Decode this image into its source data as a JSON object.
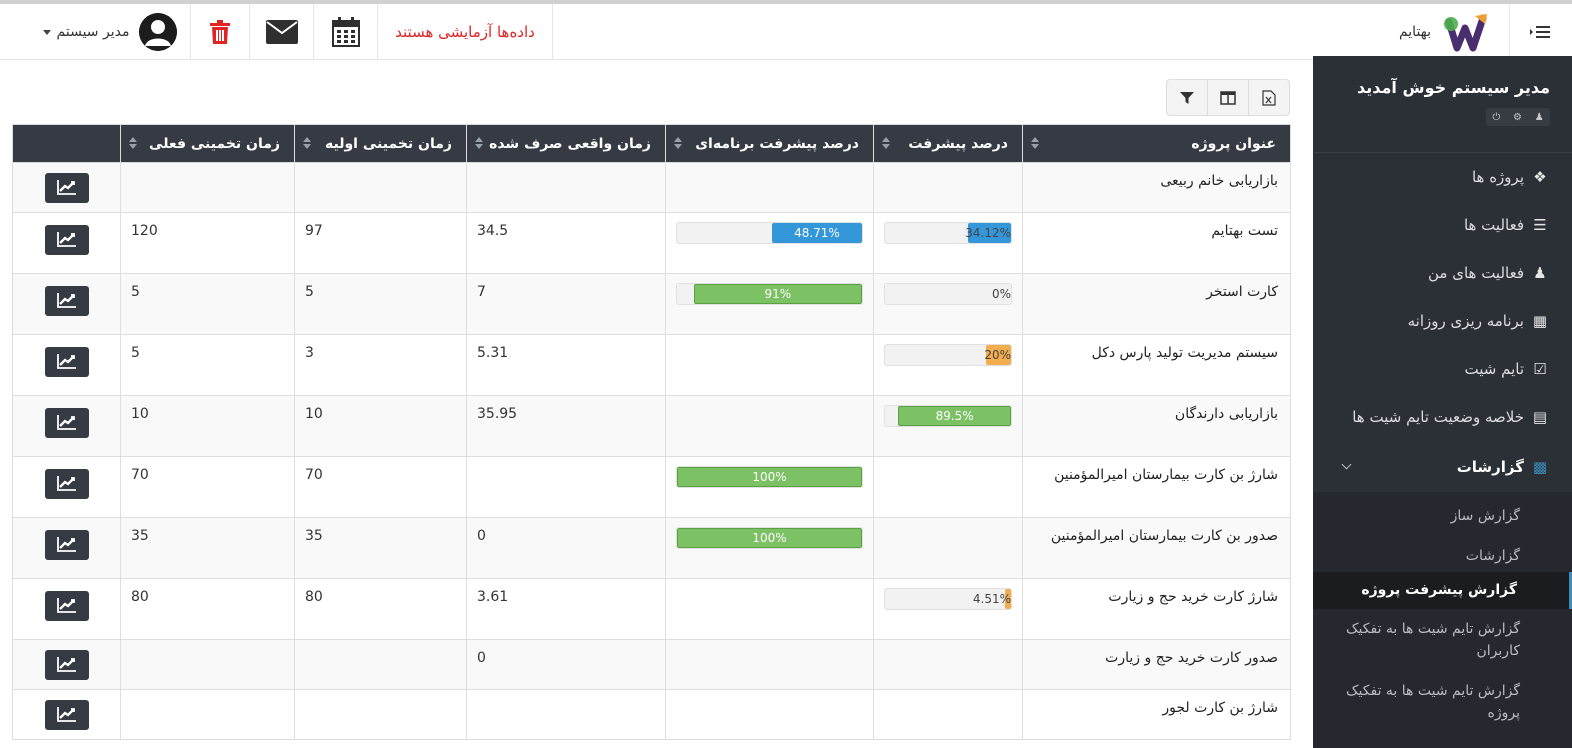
{
  "header": {
    "user_name": "مدیر سیستم",
    "demo_notice": "داده‌ها آزمایشی هستند",
    "brand_name": "بهتایم"
  },
  "sidebar": {
    "welcome": "مدیر سیستم خوش آمدید",
    "items": [
      {
        "label": "پروژه ها",
        "icon": "cubes-icon"
      },
      {
        "label": "فعالیت ها",
        "icon": "tasks-icon"
      },
      {
        "label": "فعالیت های من",
        "icon": "user-tasks-icon"
      },
      {
        "label": "برنامه ریزی روزانه",
        "icon": "table-icon"
      },
      {
        "label": "تایم شیت",
        "icon": "calendar-check-icon"
      },
      {
        "label": "خلاصه وضعیت تایم شیت ها",
        "icon": "list-alt-icon"
      },
      {
        "label": "گزارشات",
        "icon": "file-icon"
      }
    ],
    "sub_items": [
      {
        "label": "گزارش ساز"
      },
      {
        "label": "گزارشات"
      },
      {
        "label": "گزارش پیشرفت پروژه"
      },
      {
        "label": "گزارش تایم شیت ها به تفکیک کاربران"
      },
      {
        "label": "گزارش تایم شیت ها به تفکیک پروژه"
      }
    ]
  },
  "table": {
    "columns": [
      "عنوان پروژه",
      "درصد پیشرفت",
      "درصد پیشرفت برنامه‌ای",
      "زمان واقعی صرف شده",
      "زمان تخمینی اولیه",
      "زمان تخمینی فعلی"
    ],
    "rows": [
      {
        "title": "بازاریابی خانم ربیعی",
        "progress": null,
        "planned": null,
        "actual": "",
        "initial": "",
        "current": ""
      },
      {
        "title": "تست بهتایم",
        "progress": 34.12,
        "progress_label": "34.12%",
        "planned": 48.71,
        "planned_label": "48.71%",
        "actual": "34.5",
        "initial": "97",
        "current": "120"
      },
      {
        "title": "کارت استخر",
        "progress": 0,
        "progress_label": "0%",
        "planned": 91,
        "planned_label": "91%",
        "actual": "7",
        "initial": "5",
        "current": "5"
      },
      {
        "title": "سیستم مدیریت تولید پارس دکل",
        "progress": 20,
        "progress_label": "20%",
        "planned": null,
        "actual": "5.31",
        "initial": "3",
        "current": "5"
      },
      {
        "title": "بازاریابی دارندگان",
        "progress": 89.5,
        "progress_label": "89.5%",
        "planned": null,
        "actual": "35.95",
        "initial": "10",
        "current": "10"
      },
      {
        "title": "شارژ بن کارت بیمارستان امیرالمؤمنین",
        "progress": null,
        "planned": 100,
        "planned_label": "100%",
        "actual": "",
        "initial": "70",
        "current": "70"
      },
      {
        "title": "صدور بن کارت بیمارستان امیرالمؤمنین",
        "progress": null,
        "planned": 100,
        "planned_label": "100%",
        "actual": "0",
        "initial": "35",
        "current": "35"
      },
      {
        "title": "شارژ کارت خرید حج و زیارت",
        "progress": 4.51,
        "progress_label": "4.51%",
        "planned": null,
        "actual": "3.61",
        "initial": "80",
        "current": "80"
      },
      {
        "title": "صدور کارت خرید حج و زیارت",
        "progress": null,
        "planned": null,
        "actual": "0",
        "initial": "",
        "current": ""
      },
      {
        "title": "شارژ بن کارت لجور",
        "progress": null,
        "planned": null,
        "actual": "",
        "initial": "",
        "current": ""
      }
    ]
  },
  "colors": {
    "blue": "#3497da",
    "green": "#7cc164",
    "orange": "#f1ad4e",
    "danger": "#e02424",
    "sidebar": "#2b2f36"
  }
}
